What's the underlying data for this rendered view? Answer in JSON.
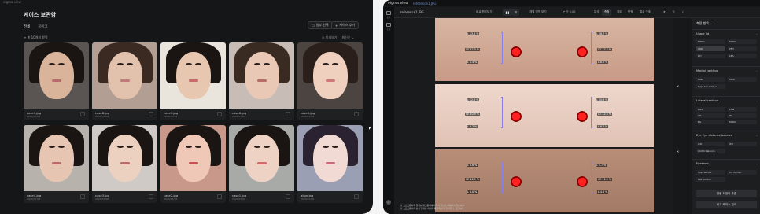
{
  "left_window": {
    "title": "eigma view",
    "heading": "케이스 보관함",
    "tabs": [
      {
        "label": "전체"
      },
      {
        "label": "북마크"
      }
    ],
    "actions": {
      "select_label": "일부 선택",
      "add_label": "케이스 추가"
    },
    "count_label": "총 10개의 항목",
    "view_option": "미리보기",
    "sort_option": "최신순",
    "cases": [
      {
        "file": "case9.jpg",
        "date": "2024/07/06"
      },
      {
        "file": "case8.jpg",
        "date": "2024/07/06"
      },
      {
        "file": "case7.jpg",
        "date": "2024/07/06"
      },
      {
        "file": "case6.jpg",
        "date": "2024/07/06"
      },
      {
        "file": "case5.jpg",
        "date": "2024/07/06"
      },
      {
        "file": "case4.jpg",
        "date": "2024/07/06"
      },
      {
        "file": "case3.jpg",
        "date": "2024/07/06"
      },
      {
        "file": "case2.jpg",
        "date": "2024/07/06"
      },
      {
        "file": "case1.jpg",
        "date": "2024/07/06"
      },
      {
        "file": "align.jpg",
        "date": "2024/07/06"
      }
    ]
  },
  "right_window": {
    "app_name": "eigma view",
    "file_tab": "reference1.JPG",
    "file_name": "reference1.JPG",
    "toolbar": {
      "compare_label": "비교 원본보기",
      "overlay_label": "개별 영역 보기",
      "zoom_label": "눈 단 0.00",
      "mode_label": "분석",
      "tool_items": [
        "측정",
        "각도",
        "면적",
        "얼굴 구조"
      ]
    },
    "nav": [
      {
        "label": "분석"
      },
      {
        "label": "도구"
      }
    ],
    "strip_measurements": [
      [
        "L 13.8 %",
        "CE 12.3 %",
        "L 0.4 %",
        "L 16.7 %",
        "CE 12.7 %",
        "L 8.0 %"
      ],
      [
        "L 12.3 %",
        "CE 10.9 %",
        "L 6.2 %",
        "L 15.9 %",
        "CE 12.4 %",
        "L 6.5 %"
      ],
      [
        "L 4.6 %",
        "CE 10.9 %",
        "L 4.0 %",
        "L 4.7 %",
        "CE 11.5 %",
        "L 4.4 %"
      ]
    ],
    "bottom_notes": [
      "본 소프트웨어의 결과는 참고용이며 의학적 진단을 대체하지 않습니다.",
      "본 소프트웨어의 분석 결과는 이미지 품질에 따라 달라질 수 있습니다."
    ],
    "panel": {
      "title": "측정 항목 ⌄",
      "sections": [
        {
          "title": "Upper lid",
          "chips": [
            "MRD1",
            "MRD2",
            "CER",
            "PFH",
            "DH",
            "LEA"
          ]
        },
        {
          "title": "Medial canthus",
          "chips": [
            "MMR",
            "MCD",
            "Pupil to canthus"
          ]
        },
        {
          "title": "Lateral canthus",
          "chips": [
            "LMR",
            "PFW",
            "VH",
            "HL",
            "EG",
            "MRD2"
          ]
        },
        {
          "title": "Eye Eye distance/balance",
          "chips": [
            "ICD",
            "IPD",
            "Width balance"
          ]
        },
        {
          "title": "Eyebrow",
          "chips": [
            "Sup. border",
            "Inf. border",
            "Mid portion"
          ]
        }
      ],
      "buttons": {
        "save": "전용 저장이 추출",
        "compare": "비교 케이스 분석"
      }
    },
    "help_label": "?",
    "colors": {
      "accent": "#8a7fe8",
      "iris": "#ff2020",
      "panel": "#1d1e20"
    }
  }
}
